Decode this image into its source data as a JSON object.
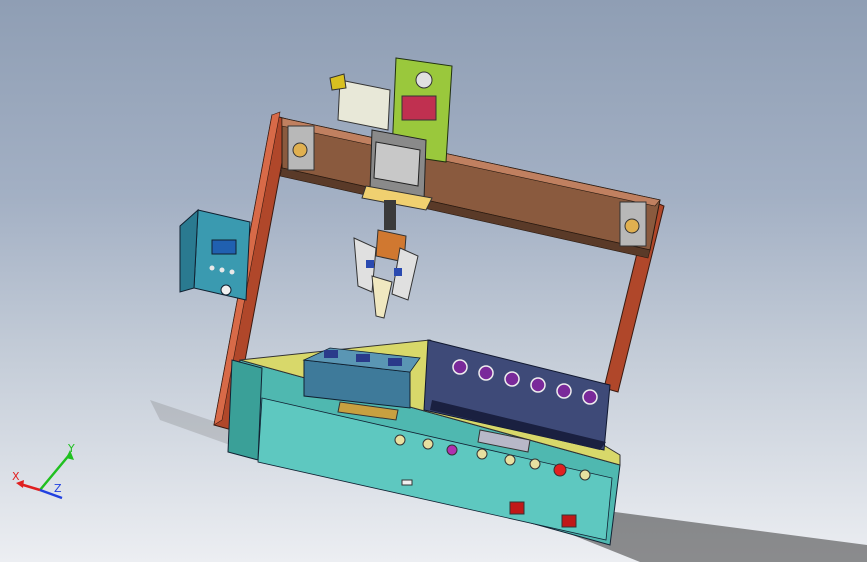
{
  "triad": {
    "x_label": "X",
    "y_label": "Y",
    "z_label": "Z",
    "x_color": "#e02020",
    "y_color": "#20c020",
    "z_color": "#2040e0"
  },
  "colors": {
    "gantry_frame": "#b0472a",
    "gantry_beam": "#8a5a3e",
    "base_top": "#d8d86a",
    "base_front": "#4fb8b0",
    "control_box": "#3a9ab0",
    "tray_dark": "#3e4a78",
    "spool": "#7a2a9a",
    "head_green": "#9ac83c"
  }
}
